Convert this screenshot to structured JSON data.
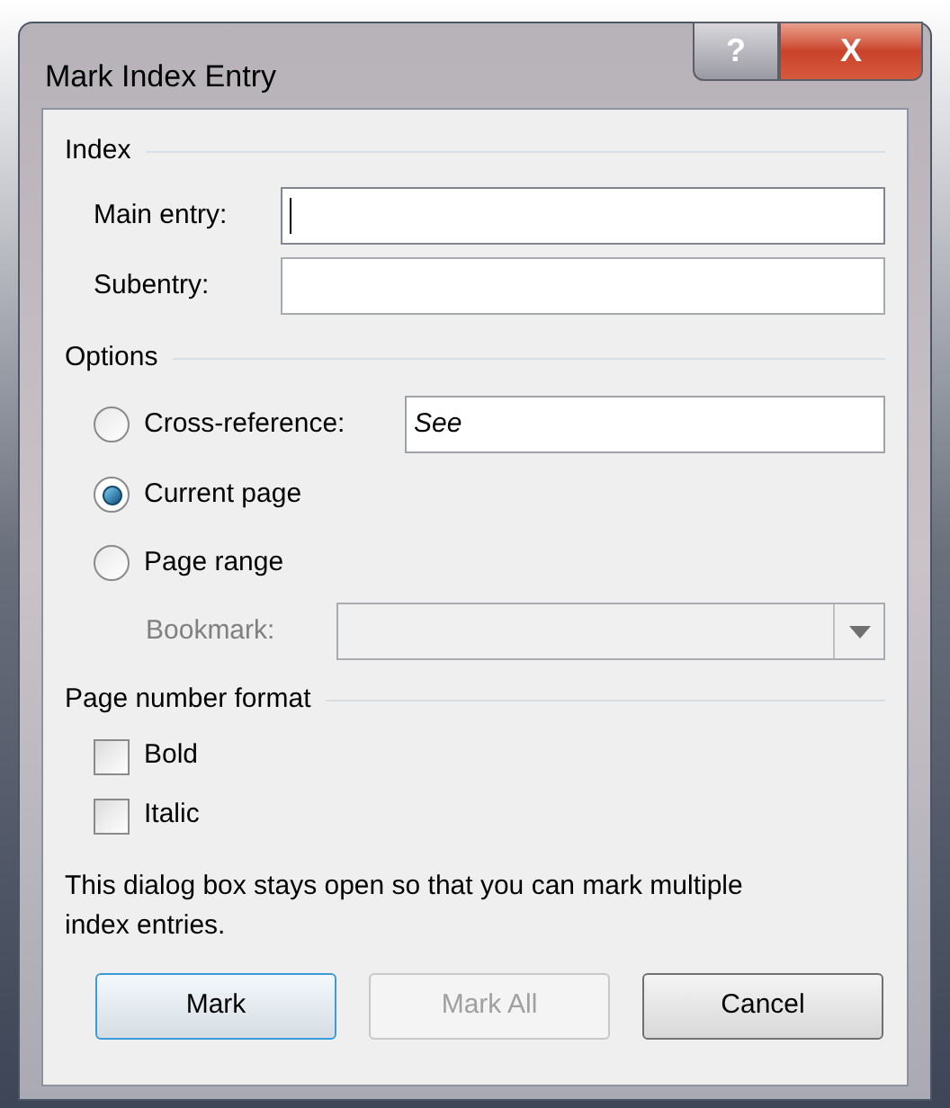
{
  "window": {
    "title": "Mark Index Entry",
    "controls": [
      "?",
      "X"
    ]
  },
  "index": {
    "title": "Index",
    "fields": [
      {
        "label": "Main entry:",
        "focused": true
      },
      {
        "label": "Subentry:",
        "focused": false
      }
    ]
  },
  "options": {
    "title": "Options",
    "items": [
      {
        "kind": "radio-field",
        "label": "Cross-reference:",
        "selected": false,
        "value": "See"
      },
      {
        "kind": "radio",
        "label": "Current page",
        "selected": true
      },
      {
        "kind": "radio",
        "label": "Page range",
        "selected": false
      },
      {
        "kind": "dropdown",
        "label": "Bookmark:",
        "disabled": true
      }
    ]
  },
  "page_number_format": {
    "title": "Page number format",
    "checkboxes": [
      {
        "label": "Bold",
        "checked": false
      },
      {
        "label": "Italic",
        "checked": false
      }
    ]
  },
  "note": "This dialog box stays open so that you can mark multiple index entries.",
  "buttons": [
    {
      "label": "Mark",
      "disabled": false,
      "default": true
    },
    {
      "label": "Mark All",
      "disabled": true,
      "default": false
    },
    {
      "label": "Cancel",
      "disabled": false,
      "default": false
    }
  ]
}
